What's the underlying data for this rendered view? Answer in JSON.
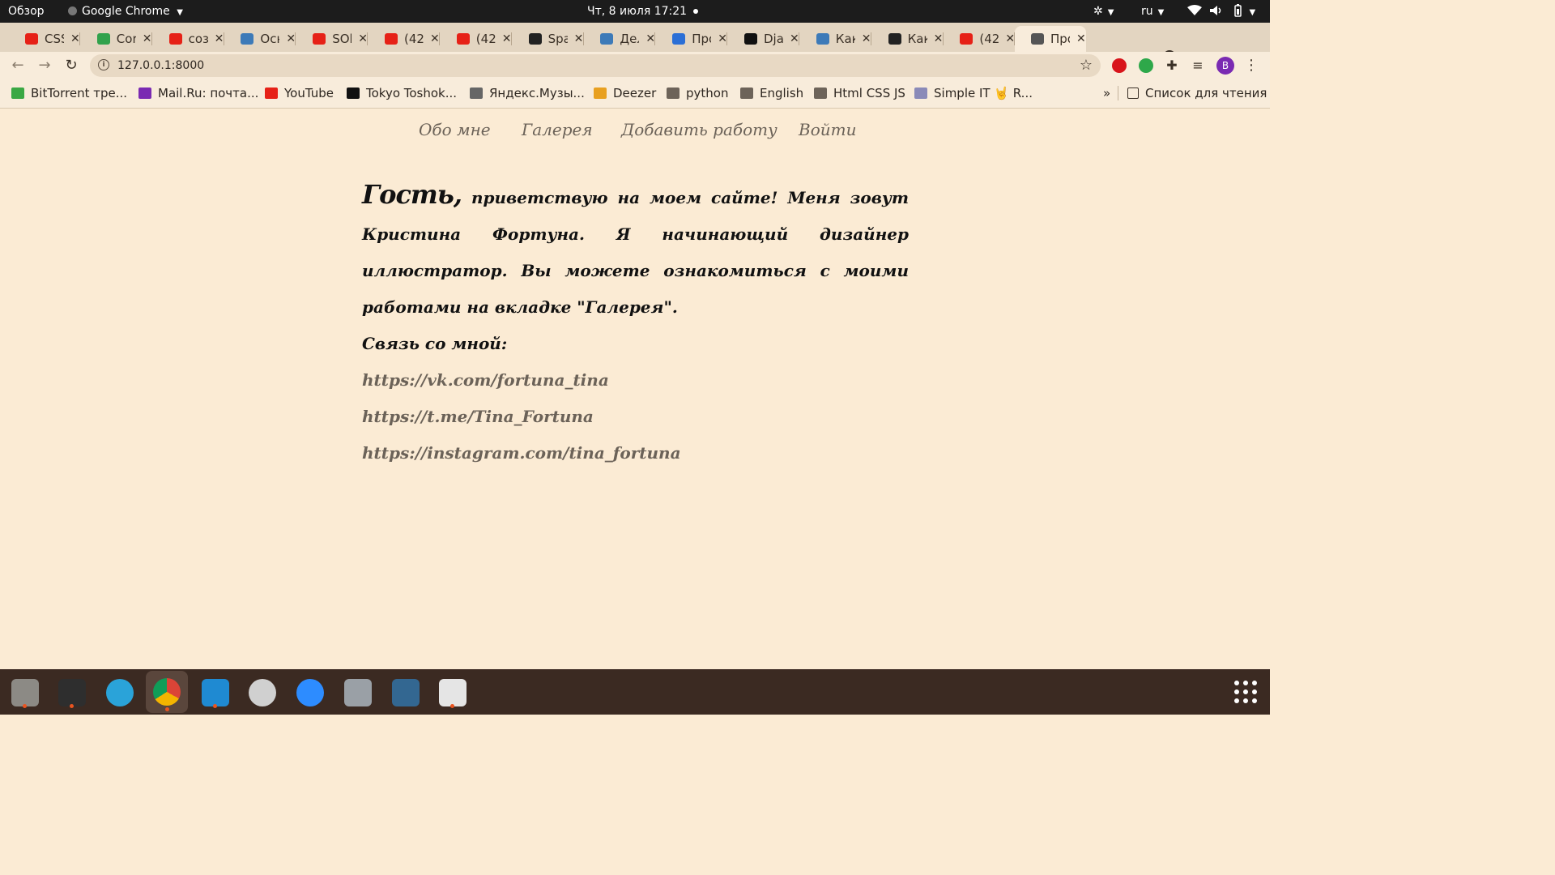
{
  "system_bar": {
    "activities": "Обзор",
    "app_name": "Google Chrome",
    "datetime": "Чт, 8 июля  17:21",
    "language": "ru"
  },
  "tabs": [
    {
      "title": "CSS",
      "icon": "youtube-icon",
      "color": "#e62117"
    },
    {
      "title": "Cor",
      "icon": "plus-circle-icon",
      "color": "#31a24c"
    },
    {
      "title": "соз",
      "icon": "youtube-icon",
      "color": "#e62117"
    },
    {
      "title": "Осн",
      "icon": "site-icon",
      "color": "#3d7ab8"
    },
    {
      "title": "SOl",
      "icon": "youtube-icon",
      "color": "#e62117"
    },
    {
      "title": "(42",
      "icon": "youtube-icon",
      "color": "#e62117"
    },
    {
      "title": "(42",
      "icon": "youtube-icon",
      "color": "#e62117"
    },
    {
      "title": "Spa",
      "icon": "github-icon",
      "color": "#222222"
    },
    {
      "title": "Дел",
      "icon": "site-icon",
      "color": "#3d7ab8"
    },
    {
      "title": "Про",
      "icon": "stripe-icon",
      "color": "#2b6fd6"
    },
    {
      "title": "Dja",
      "icon": "django-icon",
      "color": "#111111"
    },
    {
      "title": "Как",
      "icon": "site-icon",
      "color": "#3d7ab8"
    },
    {
      "title": "Как",
      "icon": "bug-icon",
      "color": "#222222"
    },
    {
      "title": "(42",
      "icon": "youtube-icon",
      "color": "#e62117"
    },
    {
      "title": "Про",
      "icon": "globe-icon",
      "color": "#555555",
      "active": true
    }
  ],
  "address_bar": {
    "url": "127.0.0.1:8000"
  },
  "profile_initial": "B",
  "bookmarks": [
    {
      "label": "BitTorrent тре...",
      "icon": "bittorrent-icon"
    },
    {
      "label": "Mail.Ru: почта...",
      "icon": "mailru-icon"
    },
    {
      "label": "YouTube",
      "icon": "youtube-icon"
    },
    {
      "label": "Tokyo Toshok...",
      "icon": "tokyo-icon"
    },
    {
      "label": "Яндекс.Музы...",
      "icon": "play-icon"
    },
    {
      "label": "Deezer",
      "icon": "deezer-icon"
    },
    {
      "label": "python",
      "icon": "folder-icon"
    },
    {
      "label": "English",
      "icon": "folder-icon"
    },
    {
      "label": "Html CSS JS",
      "icon": "folder-icon"
    },
    {
      "label": "Simple IT 🤘 R...",
      "icon": "simpleit-icon"
    }
  ],
  "bookmarks_overflow": "»",
  "reading_list": "Список для чтения",
  "site": {
    "nav": [
      "Обо мне",
      "Галерея",
      "Добавить работу",
      "Войти"
    ],
    "guest": "Гость,",
    "intro": "приветствую на моем сайте! Меня зовут Кристина Фортуна. Я начинающий дизайнер иллюстратор. Вы можете ознакомиться с моими работами на вкладке \"Галерея\".",
    "contact_title": "Связь со мной:",
    "links": [
      "https://vk.com/fortuna_tina",
      "https://t.me/Tina_Fortuna",
      "https://instagram.com/tina_fortuna"
    ]
  },
  "dock": [
    "files-icon",
    "terminal-icon",
    "telegram-icon",
    "chrome-icon",
    "vscode-icon",
    "disk-tool-icon",
    "zoom-icon",
    "database-icon",
    "postgresql-icon",
    "text-editor-icon"
  ],
  "colors": {
    "page_bg": "#fbebd4",
    "nav_text": "#6b6258",
    "link_text": "#6b6258",
    "body_text": "#111111",
    "accent": "#e95420"
  }
}
